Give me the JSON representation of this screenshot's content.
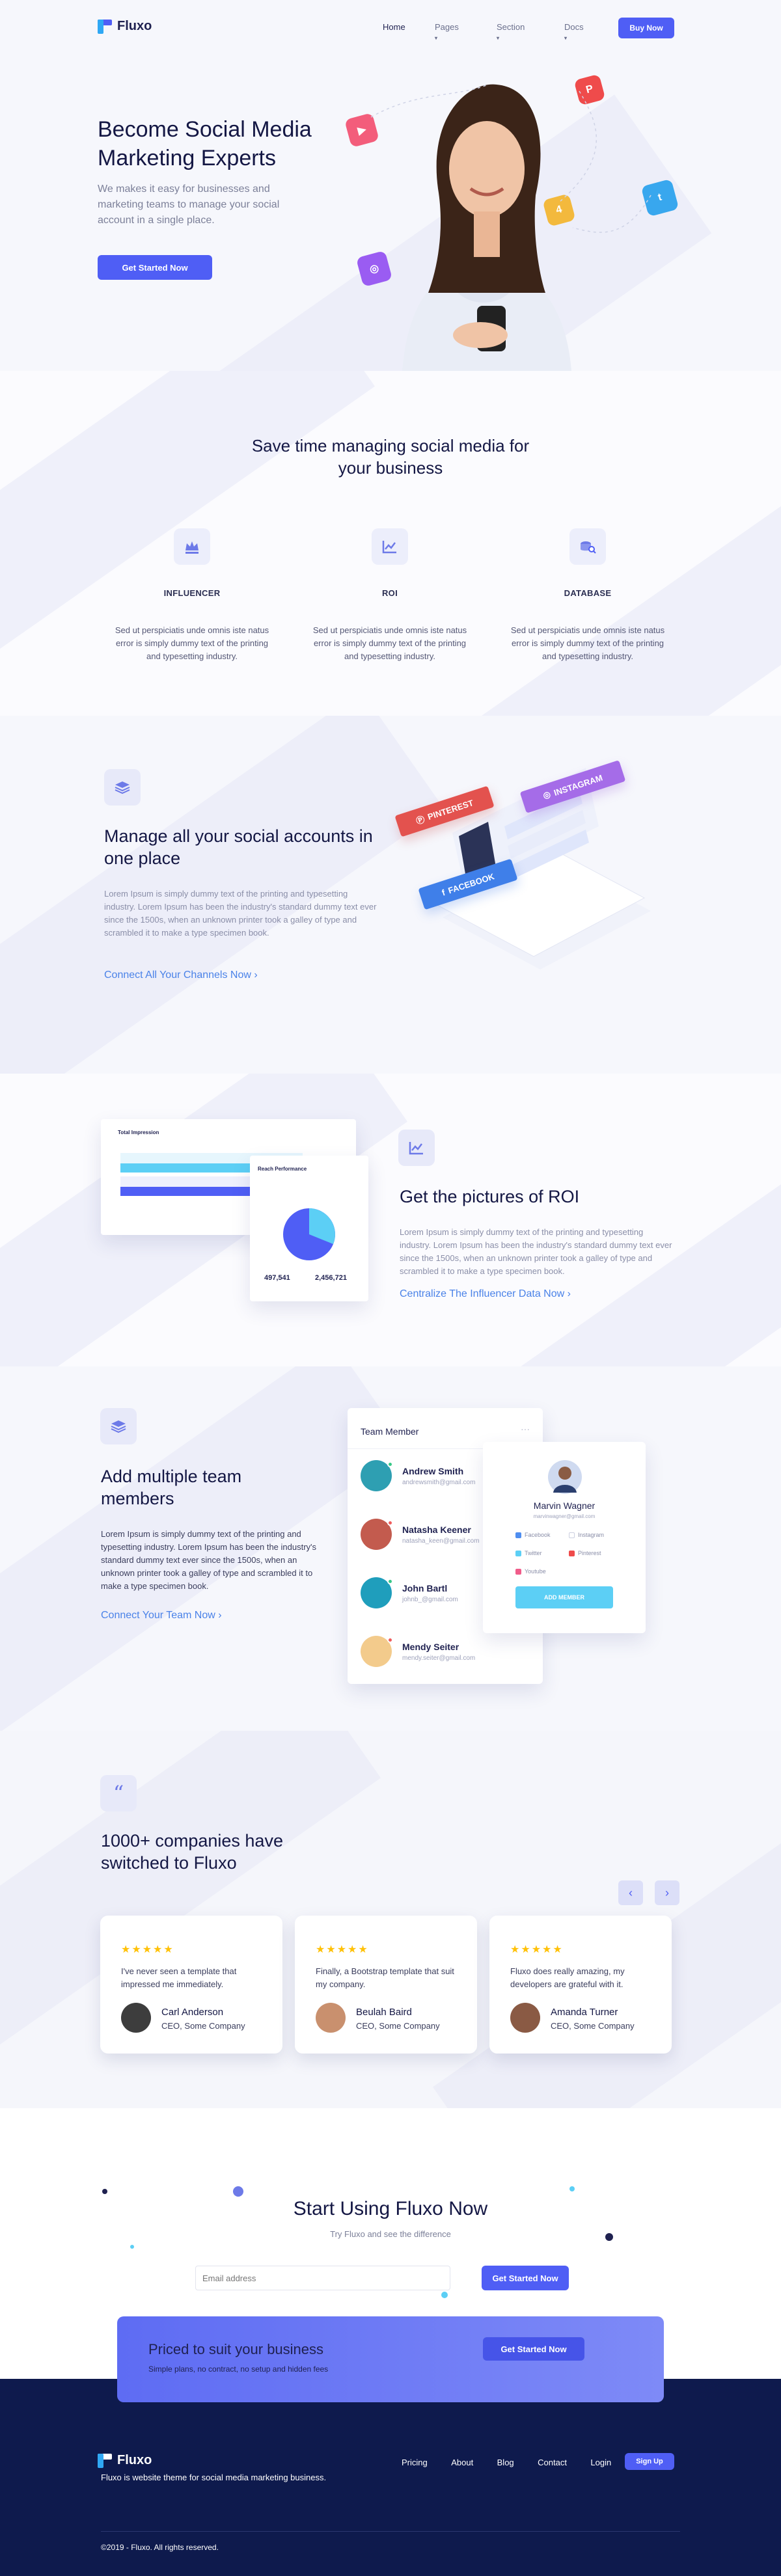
{
  "nav": {
    "brand": "Fluxo",
    "links": [
      "Home",
      "Pages",
      "Section",
      "Docs"
    ],
    "buy_label": "Buy Now"
  },
  "hero": {
    "title": "Become Social Media Marketing Experts",
    "text": "We makes it easy for businesses and marketing teams to manage your social account in a single place.",
    "cta": "Get Started Now"
  },
  "features": {
    "title": "Save time managing social media for your business",
    "items": [
      {
        "title": "INFLUENCER",
        "text": "Sed ut perspiciatis unde omnis iste natus error is simply dummy text of the printing and typesetting industry.",
        "icon": "crown-icon"
      },
      {
        "title": "ROI",
        "text": "Sed ut perspiciatis unde omnis iste natus error is simply dummy text of the printing and typesetting industry.",
        "icon": "chart-icon"
      },
      {
        "title": "DATABASE",
        "text": "Sed ut perspiciatis unde omnis iste natus error is simply dummy text of the printing and typesetting industry.",
        "icon": "database-search-icon"
      }
    ]
  },
  "manage": {
    "title": "Manage all your social accounts in one place",
    "text": "Lorem Ipsum is simply dummy text of the printing and typesetting industry. Lorem Ipsum has been the industry's standard dummy text ever since the 1500s, when an unknown printer took a galley of type and scrambled it to make a type specimen book.",
    "link": "Connect All Your Channels Now",
    "tags": [
      "PINTEREST",
      "INSTAGRAM",
      "FACEBOOK"
    ]
  },
  "roi": {
    "title": "Get the pictures of ROI",
    "text": "Lorem Ipsum is simply dummy text of the printing and typesetting industry. Lorem Ipsum has been the industry's standard dummy text ever since the 1500s, when an unknown printer took a galley of type and scrambled it to make a type specimen book.",
    "link": "Centralize The Influencer Data Now",
    "mock": {
      "left_title": "Total Impression",
      "right_title": "Reach Performance",
      "stat1": "497,541",
      "stat2": "2,456,721"
    }
  },
  "team": {
    "title": "Add multiple team members",
    "text": "Lorem Ipsum is simply dummy text of the printing and typesetting industry. Lorem Ipsum has been the industry's standard dummy text ever since the 1500s, when an unknown printer took a galley of type and scrambled it to make a type specimen book.",
    "link": "Connect Your Team Now",
    "panel_title": "Team Member",
    "members": [
      {
        "name": "Andrew Smith",
        "email": "andrewsmith@gmail.com"
      },
      {
        "name": "Natasha Keener",
        "email": "natasha_keen@gmail.com"
      },
      {
        "name": "John Bartl",
        "email": "johnb_@gmail.com"
      },
      {
        "name": "Mendy Seiter",
        "email": "mendy.seiter@gmail.com"
      }
    ],
    "profile": {
      "name": "Marvin Wagner",
      "email": "marvinwagner@gmail.com",
      "options": [
        "Facebook",
        "Instagram",
        "Twitter",
        "Pinterest",
        "Youtube"
      ],
      "button": "ADD MEMBER"
    }
  },
  "testimonials": {
    "title": "1000+ companies have switched to Fluxo",
    "items": [
      {
        "text": "I've never seen a template that impressed me immediately.",
        "name": "Carl Anderson",
        "role": "CEO, Some Company"
      },
      {
        "text": "Finally, a Bootstrap template that suit my company.",
        "name": "Beulah Baird",
        "role": "CEO, Some Company"
      },
      {
        "text": "Fluxo does really amazing, my developers are grateful with it.",
        "name": "Amanda Turner",
        "role": "CEO, Some Company"
      }
    ]
  },
  "start": {
    "title": "Start Using Fluxo Now",
    "subtitle": "Try Fluxo and see the difference",
    "email_placeholder": "Email address",
    "cta": "Get Started Now"
  },
  "pricing_cta": {
    "title": "Priced to suit your business",
    "text": "Simple plans, no contract, no setup and hidden fees",
    "cta": "Get Started Now"
  },
  "footer": {
    "brand": "Fluxo",
    "tagline": "Fluxo is website theme for social media marketing business.",
    "links": [
      "Pricing",
      "About",
      "Blog",
      "Contact",
      "Login"
    ],
    "signup": "Sign Up",
    "copyright": "©2019 - Fluxo. All rights reserved."
  },
  "colors": {
    "accent": "#4f5ef5",
    "link": "#4a82e8",
    "footer_bg": "#0e1a4d"
  }
}
